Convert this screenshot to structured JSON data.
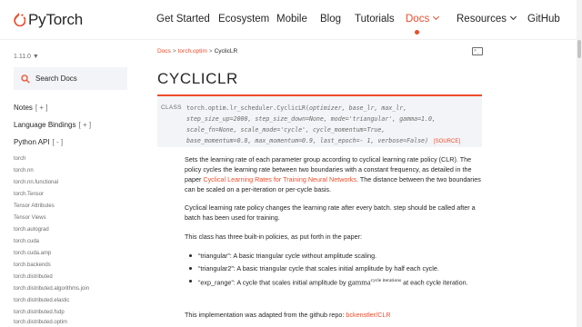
{
  "header": {
    "logo_text": "PyTorch",
    "nav": [
      {
        "label": "Get Started"
      },
      {
        "label": "Ecosystem"
      },
      {
        "label": "Mobile"
      },
      {
        "label": "Blog"
      },
      {
        "label": "Tutorials"
      },
      {
        "label": "Docs"
      },
      {
        "label": "Resources"
      },
      {
        "label": "GitHub"
      }
    ],
    "accent_color": "#ee4c2c"
  },
  "sidebar": {
    "version": "1.11.0 ▼",
    "search_placeholder": "Search Docs",
    "sections": [
      {
        "label": "Notes",
        "toggle": "[ + ]"
      },
      {
        "label": "Language Bindings",
        "toggle": "[ + ]"
      },
      {
        "label": "Python API",
        "toggle": "[ - ]"
      }
    ],
    "links": [
      "torch",
      "torch.nn",
      "torch.nn.functional",
      "torch.Tensor",
      "Tensor Attributes",
      "Tensor Views",
      "torch.autograd",
      "torch.cuda",
      "torch.cuda.amp",
      "torch.backends",
      "torch.distributed",
      "torch.distributed.algorithms.join",
      "torch.distributed.elastic",
      "torch.distributed.fsdp",
      "torch.distributed.optim"
    ]
  },
  "breadcrumb": {
    "items": [
      "Docs",
      "torch.optim",
      "CyclicLR"
    ],
    "separator": ">"
  },
  "page": {
    "title": "CYCLICLR",
    "signature": {
      "kind": "CLASS",
      "name": "torch.optim.lr_scheduler.CyclicLR(",
      "line1_params": "optimizer, base_lr, max_lr,",
      "line2": "step_size_up=2000, step_size_down=None, mode='triangular', gamma=1.0,",
      "line3": "scale_fn=None, scale_mode='cycle', cycle_momentum=True,",
      "line4": "base_momentum=0.8, max_momentum=0.9, last_epoch=- 1, verbose=False)",
      "source": "[SOURCE]"
    },
    "para1": {
      "text1": "Sets the learning rate of each parameter group according to cyclical learning rate policy (CLR). The policy cycles the learning rate between two boundaries with a constant frequency, as detailed in the paper ",
      "link": "Cyclical Learning Rates for Training Neural Networks",
      "text2": ". The distance between the two boundaries can be scaled on a per-iteration or per-cycle basis."
    },
    "para2": "Cyclical learning rate policy changes the learning rate after every batch. step should be called after a batch has been used for training.",
    "para3": "This class has three built-in policies, as put forth in the paper:",
    "bullets": [
      "“triangular”: A basic triangular cycle without amplitude scaling.",
      "“triangular2”: A basic triangular cycle that scales initial amplitude by half each cycle."
    ],
    "bullet3": {
      "prefix": "“exp_range”: A cycle that scales initial amplitude by ",
      "math_base": "gamma",
      "math_exp": "cycle iterations",
      "suffix": " at each cycle iteration."
    },
    "para4": {
      "text": "This implementation was adapted from the github repo: ",
      "link": "bckenstler/CLR"
    }
  }
}
